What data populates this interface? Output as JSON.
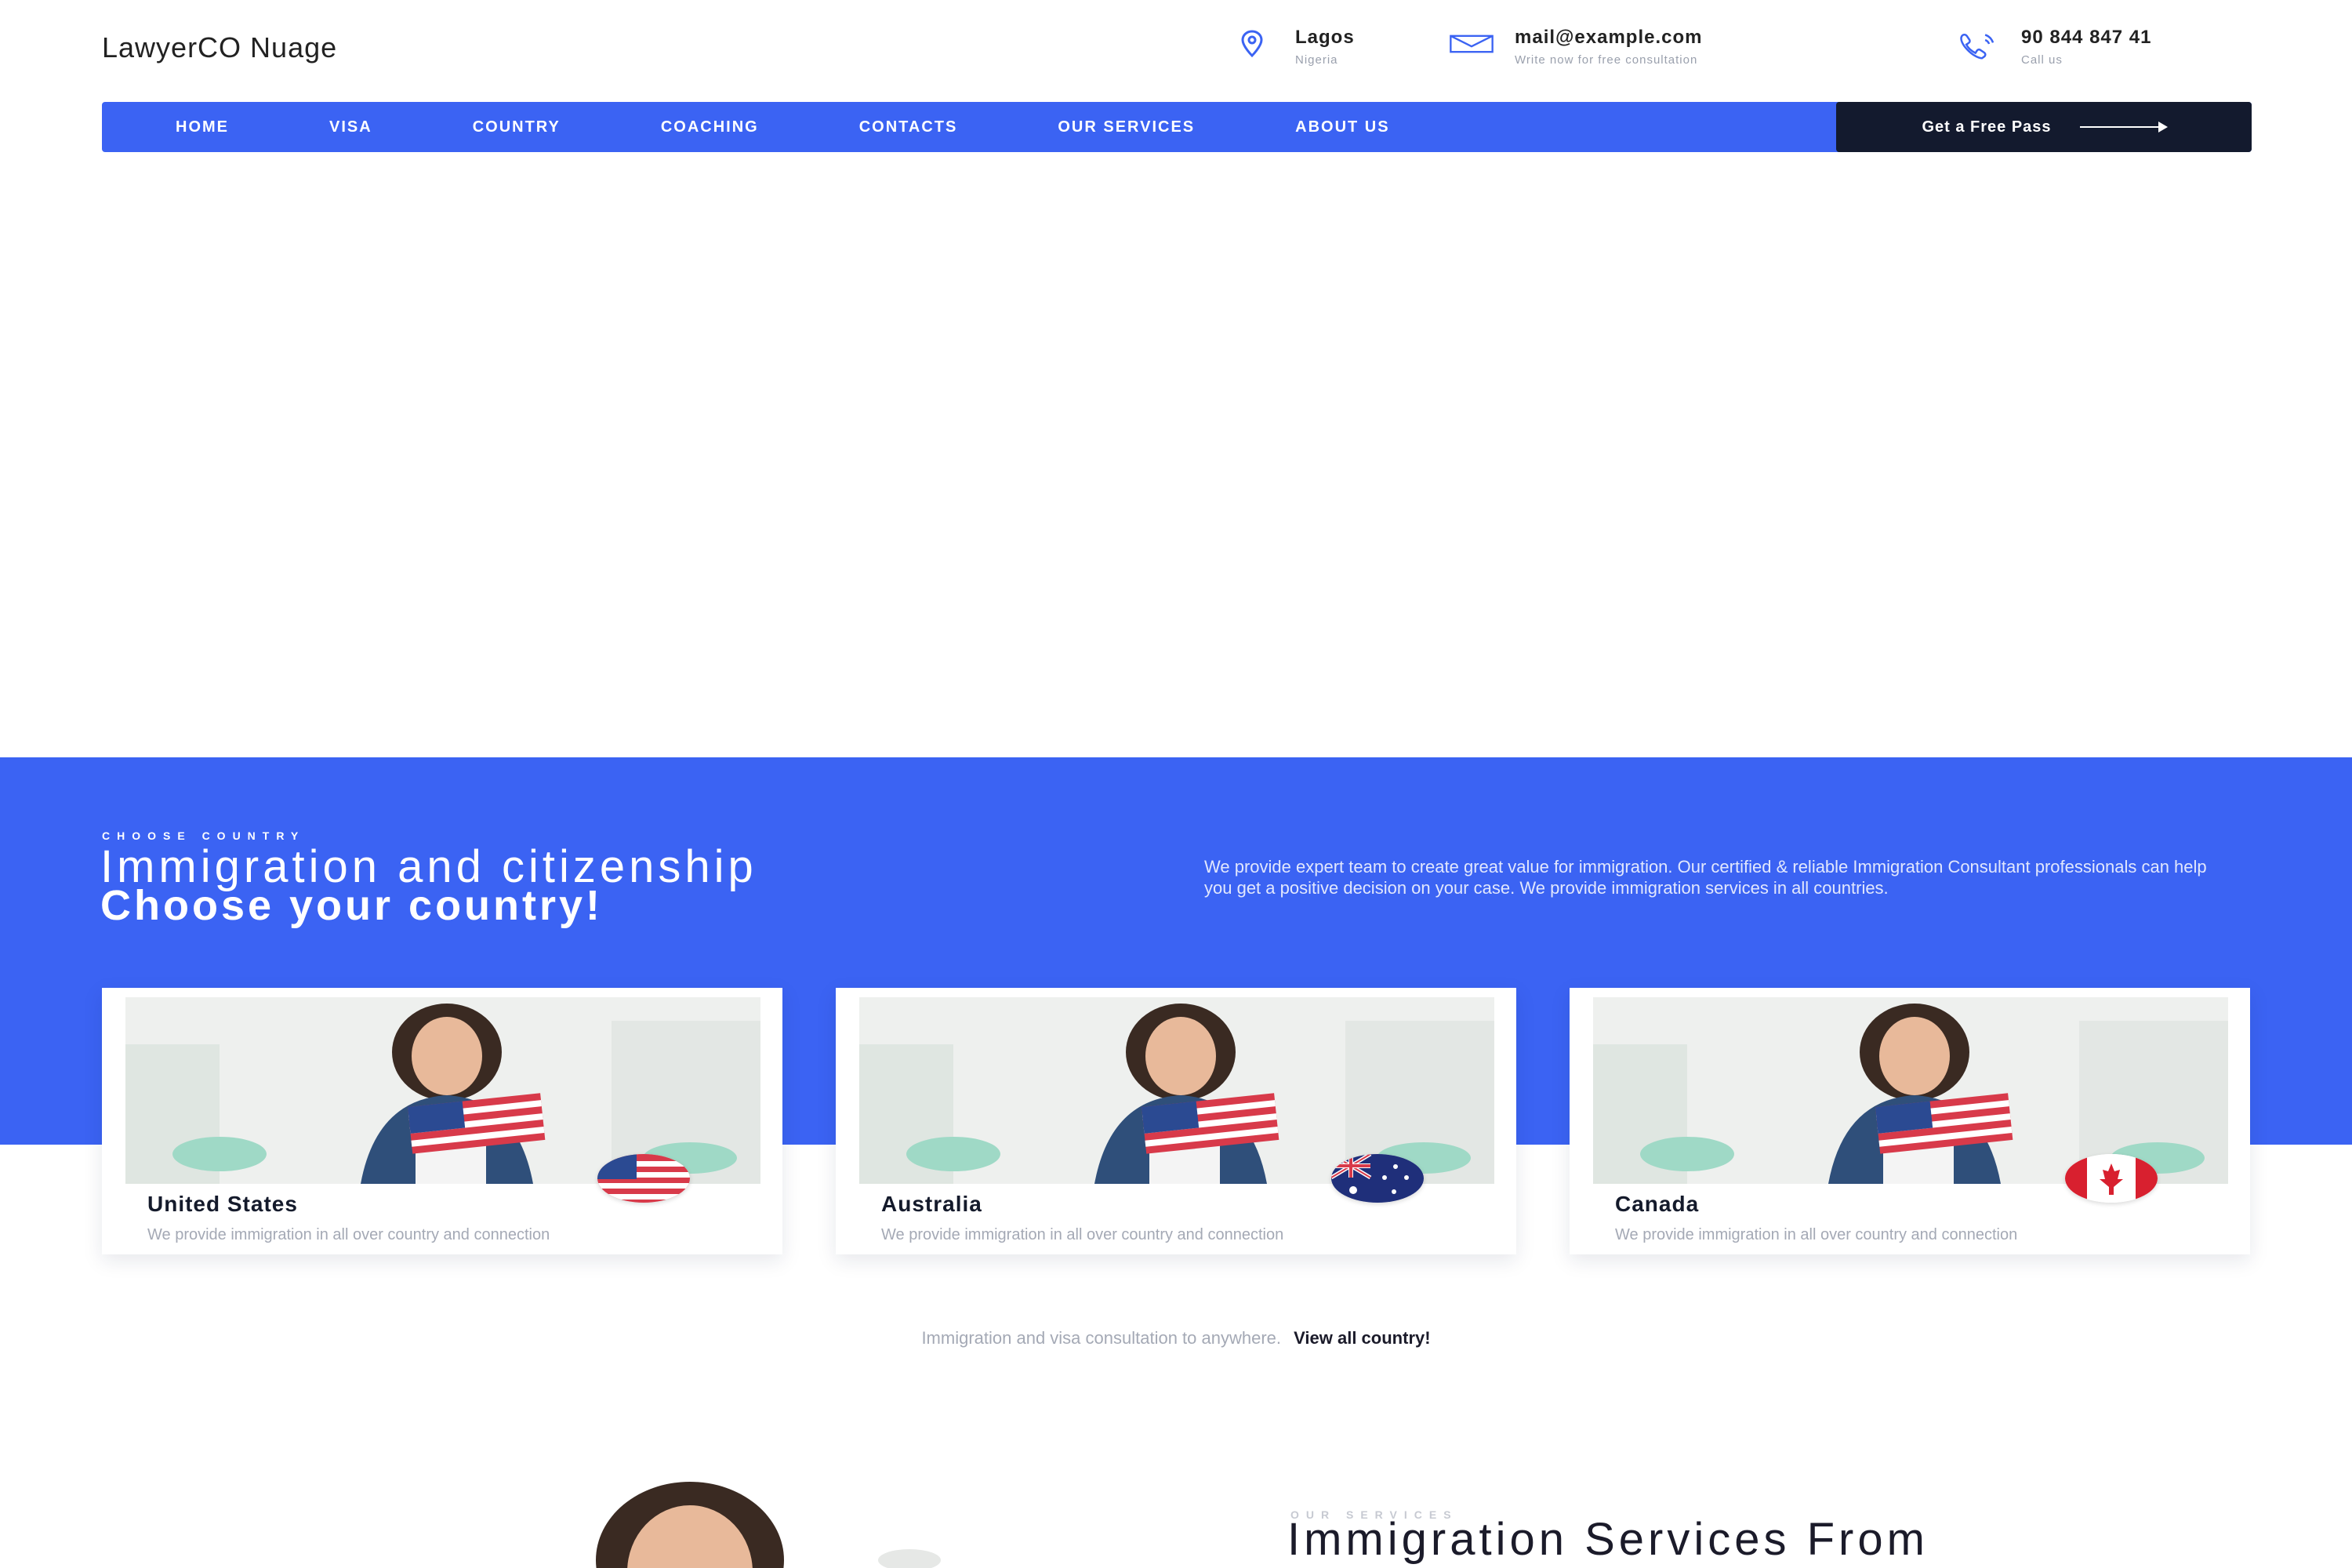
{
  "header": {
    "brand": "LawyerCO Nuage",
    "location": {
      "main": "Lagos",
      "sub": "Nigeria",
      "icon": "location-pin-icon"
    },
    "email": {
      "main": "mail@example.com",
      "sub": "Write now for free consultation",
      "icon": "envelope-icon"
    },
    "phone": {
      "main": "90 844 847 41",
      "sub": "Call us",
      "icon": "phone-icon"
    }
  },
  "nav": {
    "items": [
      "HOME",
      "VISA",
      "COUNTRY",
      "COACHING",
      "CONTACTS",
      "OUR SERVICES",
      "ABOUT US"
    ],
    "cta": "Get a Free Pass"
  },
  "section": {
    "eyebrow": "CHOOSE COUNTRY",
    "title_line1": "Immigration and citizenship",
    "title_line2": "Choose your country!",
    "intro": "We provide expert team to create great value for immigration. Our certified & reliable Immigration Consultant professionals can help you get a positive decision on your case. We provide immigration services in all countries."
  },
  "countries": [
    {
      "name": "United States",
      "desc": "We provide immigration in all over country and connection",
      "flag": "us-flag-icon"
    },
    {
      "name": "Australia",
      "desc": "We provide immigration in all over country and connection",
      "flag": "australia-flag-icon"
    },
    {
      "name": "Canada",
      "desc": "We provide immigration in all over country and connection",
      "flag": "canada-flag-icon"
    }
  ],
  "promo": {
    "text": "Immigration and visa consultation to anywhere.",
    "link": "View all country!"
  },
  "teaser": {
    "eyebrow": "OUR SERVICES",
    "title": "Immigration Services From"
  },
  "colors": {
    "primary": "#3b63f3",
    "dark": "#131a2e",
    "muted": "#a4a9b5"
  }
}
